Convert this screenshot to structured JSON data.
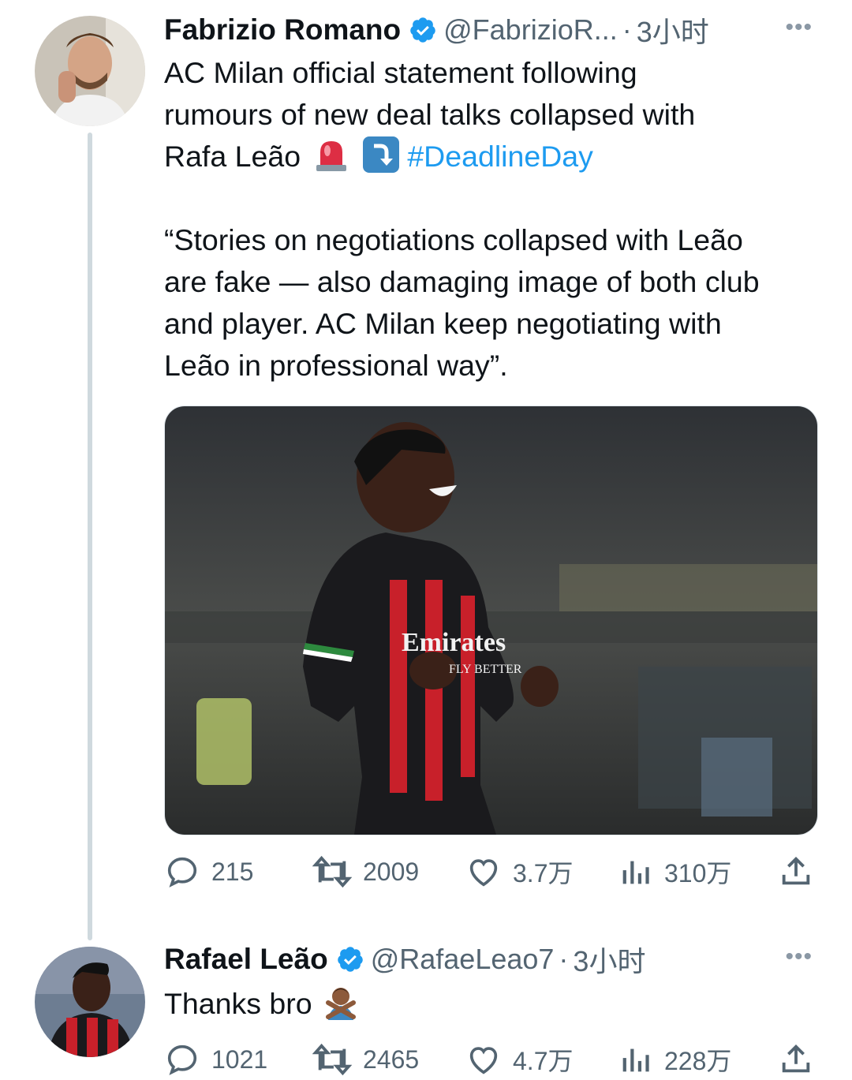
{
  "tweets": [
    {
      "name": "Fabrizio Romano",
      "handle": "@FabrizioR...",
      "sep": "·",
      "time": "3小时",
      "more": "•••",
      "text_lines": [
        "AC Milan official statement following",
        "rumours of new deal talks collapsed with",
        "Rafa Leão"
      ],
      "hashtag": "#DeadlineDay",
      "quote_lines": [
        "“Stories on negotiations collapsed with Leão",
        "are fake — also damaging image of both club",
        "and player. AC Milan keep negotiating with",
        "Leão in professional way”."
      ],
      "media": {
        "jersey_text": "Emirates",
        "jersey_sub": "FLY BETTER"
      },
      "actions": {
        "replies": "215",
        "retweets": "2009",
        "likes": "3.7万",
        "views": "310万"
      }
    },
    {
      "name": "Rafael Leão",
      "handle": "@RafaeLeao7",
      "sep": "·",
      "time": "3小时",
      "more": "•••",
      "text": "Thanks bro",
      "actions": {
        "replies": "1021",
        "retweets": "2465",
        "likes": "4.7万",
        "views": "228万"
      }
    }
  ],
  "icons": {
    "verified": "verified-badge-icon",
    "reply": "reply-icon",
    "retweet": "retweet-icon",
    "like": "heart-icon",
    "views": "views-icon",
    "share": "share-icon"
  },
  "colors": {
    "accent": "#1d9bf0",
    "muted": "#536471",
    "text": "#0f1419",
    "thread": "#cfd9de"
  }
}
